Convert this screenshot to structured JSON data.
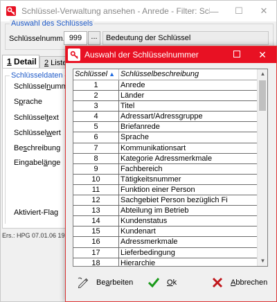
{
  "main_window": {
    "title": "Schlüssel-Verwaltung ansehen - Anrede - Filter: Sch_SchN",
    "controls": {
      "minimize": "—",
      "maximize": "☐",
      "close": "✕"
    },
    "selection_group": {
      "title": "Auswahl des Schlüssels",
      "key_number_label": "Schlüsselnumm.",
      "key_number_value": "999",
      "lookup_button": "...",
      "description_value": "Bedeutung der Schlüssel"
    },
    "tabs": [
      {
        "num": "1",
        "label": " Detail"
      },
      {
        "num": "2",
        "label": " Liste"
      }
    ],
    "detail_group": {
      "title": "Schlüsseldaten",
      "fields": [
        {
          "pre": "Schlüssel",
          "acc": "n",
          "post": "umm."
        },
        {
          "pre": "S",
          "acc": "p",
          "post": "rache"
        },
        {
          "pre": "Schlüssel",
          "acc": "t",
          "post": "ext"
        },
        {
          "pre": "Schlüssel",
          "acc": "w",
          "post": "ert"
        },
        {
          "pre": "Be",
          "acc": "s",
          "post": "chreibung"
        },
        {
          "pre": "Eingabel",
          "acc": "ä",
          "post": "nge"
        },
        {
          "pre": "Aktiviert-Flag",
          "acc": "",
          "post": ""
        }
      ]
    },
    "status_text": "Ers.: HPG 07.01.06 19"
  },
  "dialog": {
    "title": "Auswahl der Schlüsselnummer",
    "controls": {
      "maximize": "☐",
      "close": "✕"
    },
    "columns": [
      "Schlüssel",
      "Schlüsselbeschreibung"
    ],
    "rows": [
      {
        "key": "1",
        "desc": "Anrede"
      },
      {
        "key": "2",
        "desc": "Länder"
      },
      {
        "key": "3",
        "desc": "Titel"
      },
      {
        "key": "4",
        "desc": "Adressart/Adressgruppe"
      },
      {
        "key": "5",
        "desc": "Briefanrede"
      },
      {
        "key": "6",
        "desc": "Sprache"
      },
      {
        "key": "7",
        "desc": "Kommunikationsart"
      },
      {
        "key": "8",
        "desc": "Kategorie Adressmerkmale"
      },
      {
        "key": "9",
        "desc": "Fachbereich"
      },
      {
        "key": "10",
        "desc": "Tätigkeitsnummer"
      },
      {
        "key": "11",
        "desc": "Funktion einer Person"
      },
      {
        "key": "12",
        "desc": "Sachgebiet Person bezüglich Fi"
      },
      {
        "key": "13",
        "desc": "Abteilung im Betrieb"
      },
      {
        "key": "14",
        "desc": "Kundenstatus"
      },
      {
        "key": "15",
        "desc": "Kundenart"
      },
      {
        "key": "16",
        "desc": "Adressmerkmale"
      },
      {
        "key": "17",
        "desc": "Lieferbedingung"
      },
      {
        "key": "18",
        "desc": "Hierarchie"
      }
    ],
    "buttons": {
      "edit": {
        "pre": "Be",
        "acc": "a",
        "post": "rbeiten"
      },
      "ok": {
        "pre": "",
        "acc": "O",
        "post": "k"
      },
      "cancel": {
        "pre": "",
        "acc": "A",
        "post": "bbrechen"
      }
    },
    "colors": {
      "title_bar": "#e81123",
      "ok_check": "#1a9a1a",
      "cancel_x": "#c0161b"
    }
  }
}
